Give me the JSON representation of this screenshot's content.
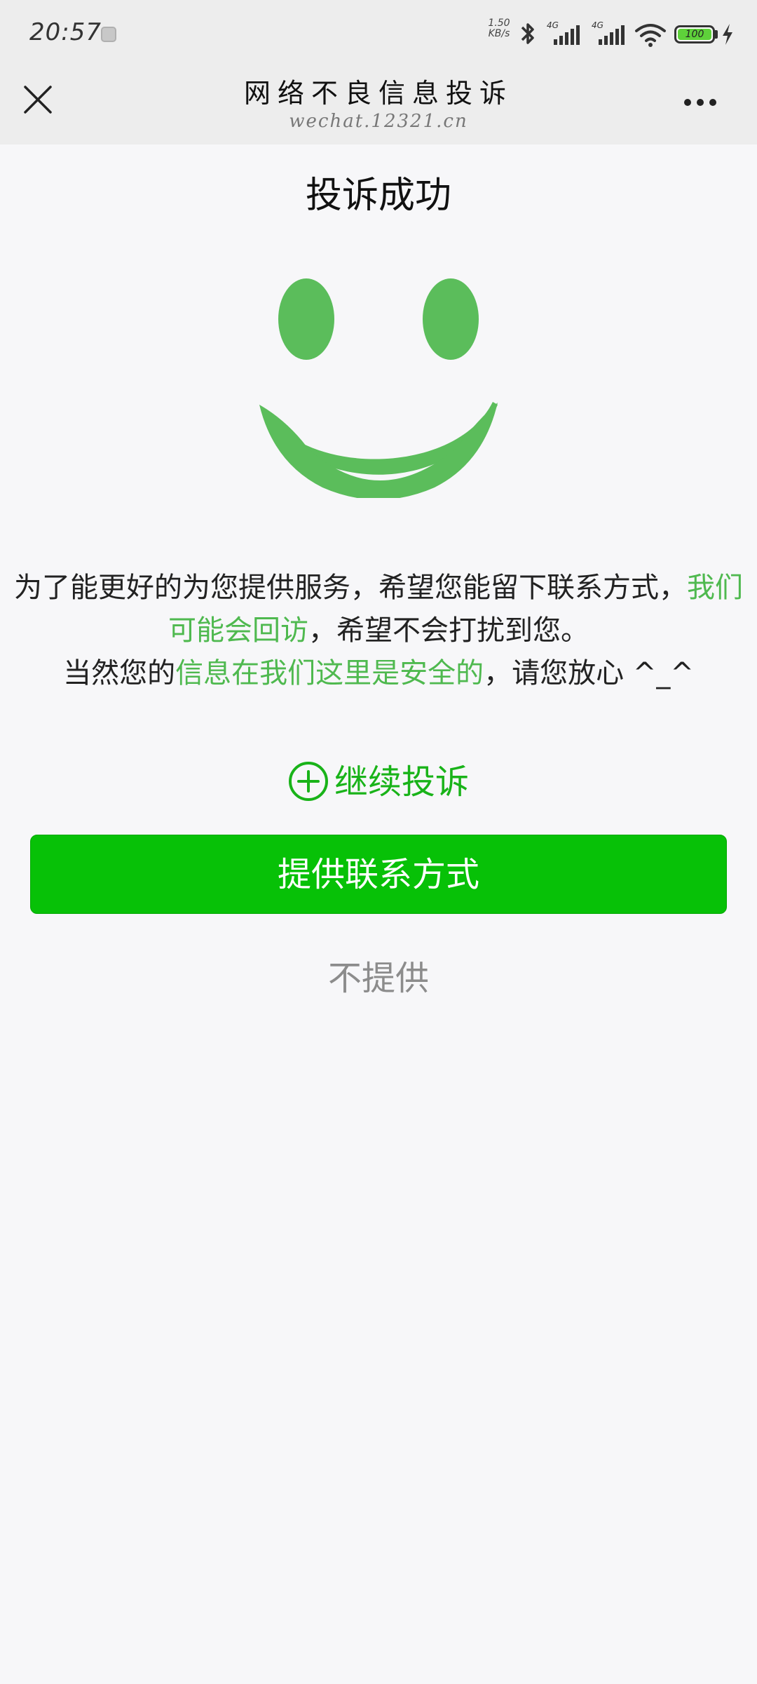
{
  "status_bar": {
    "time": "20:57",
    "net_speed_value": "1.50",
    "net_speed_unit": "KB/s",
    "signal_label_1": "4G",
    "signal_label_2": "4G",
    "battery": "100"
  },
  "nav": {
    "title": "网络不良信息投诉",
    "subtitle": "wechat.12321.cn"
  },
  "main": {
    "title": "投诉成功",
    "message": {
      "p1": "为了能更好的为您提供服务，希望您能留下联系方式，",
      "p1_highlight": "我们可能会回访",
      "p2": "，希望不会打扰到您。",
      "p3": "当然您的",
      "p3_highlight": "信息在我们这里是安全的",
      "p4": "，请您放心 ^_^"
    },
    "continue_label": "继续投诉",
    "primary_button": "提供联系方式",
    "secondary_button": "不提供"
  },
  "colors": {
    "accent_green": "#07c107",
    "smiley_green": "#5bbd5b",
    "highlight_green": "#4fb94f"
  },
  "icons": [
    "close-icon",
    "more-icon",
    "plus-circle-icon",
    "smiley-icon",
    "bluetooth-icon",
    "wifi-icon",
    "battery-icon"
  ]
}
